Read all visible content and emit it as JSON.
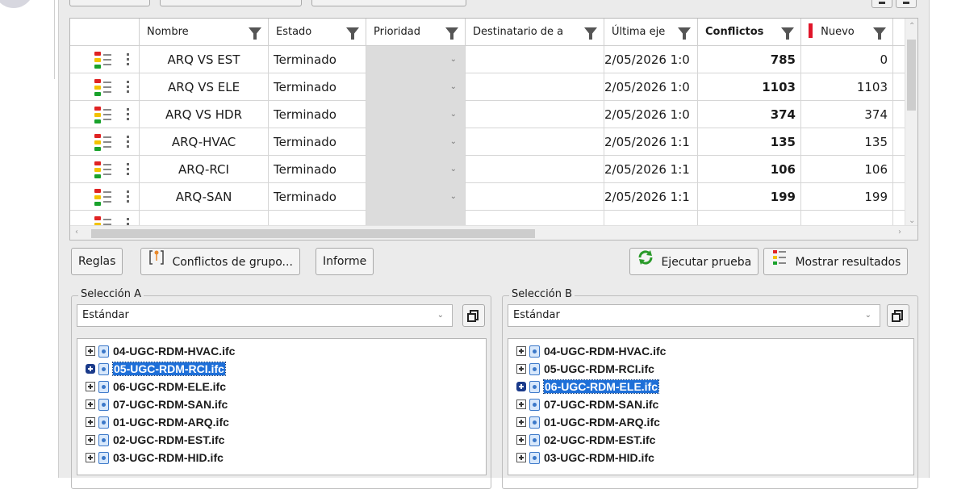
{
  "grid": {
    "headers": {
      "nombre": "Nombre",
      "estado": "Estado",
      "prioridad": "Prioridad",
      "destinatario": "Destinatario de a",
      "ultima": "Última eje",
      "conflictos": "Conflictos",
      "nuevo": "Nuevo"
    },
    "rows": [
      {
        "nombre": "ARQ VS EST",
        "estado": "Terminado",
        "ultima": "2/05/2026 1:0",
        "conflictos": "785",
        "nuevo": "0"
      },
      {
        "nombre": "ARQ VS ELE",
        "estado": "Terminado",
        "ultima": "2/05/2026 1:0",
        "conflictos": "1103",
        "nuevo": "1103"
      },
      {
        "nombre": "ARQ VS HDR",
        "estado": "Terminado",
        "ultima": "2/05/2026 1:0",
        "conflictos": "374",
        "nuevo": "374"
      },
      {
        "nombre": "ARQ-HVAC",
        "estado": "Terminado",
        "ultima": "2/05/2026 1:1",
        "conflictos": "135",
        "nuevo": "135"
      },
      {
        "nombre": "ARQ-RCI",
        "estado": "Terminado",
        "ultima": "2/05/2026 1:1",
        "conflictos": "106",
        "nuevo": "106"
      },
      {
        "nombre": "ARQ-SAN",
        "estado": "Terminado",
        "ultima": "2/05/2026 1:1",
        "conflictos": "199",
        "nuevo": "199"
      }
    ],
    "priority_value": "",
    "status_colors": {
      "red": "#e02323",
      "yellow": "#f2c200",
      "green": "#19a22b"
    }
  },
  "actions": {
    "reglas": "Reglas",
    "conflictos_grupo": "Conflictos de grupo...",
    "informe": "Informe",
    "ejecutar": "Ejecutar prueba",
    "mostrar": "Mostrar resultados"
  },
  "selection_a": {
    "title": "Selección A",
    "combo": "Estándar",
    "items": [
      {
        "label": "04-UGC-RDM-HVAC.ifc",
        "selected": false
      },
      {
        "label": "05-UGC-RDM-RCI.ifc",
        "selected": true
      },
      {
        "label": "06-UGC-RDM-ELE.ifc",
        "selected": false
      },
      {
        "label": "07-UGC-RDM-SAN.ifc",
        "selected": false
      },
      {
        "label": "01-UGC-RDM-ARQ.ifc",
        "selected": false
      },
      {
        "label": "02-UGC-RDM-EST.ifc",
        "selected": false
      },
      {
        "label": "03-UGC-RDM-HID.ifc",
        "selected": false
      }
    ]
  },
  "selection_b": {
    "title": "Selección B",
    "combo": "Estándar",
    "items": [
      {
        "label": "04-UGC-RDM-HVAC.ifc",
        "selected": false
      },
      {
        "label": "05-UGC-RDM-RCI.ifc",
        "selected": false
      },
      {
        "label": "06-UGC-RDM-ELE.ifc",
        "selected": true
      },
      {
        "label": "07-UGC-RDM-SAN.ifc",
        "selected": false
      },
      {
        "label": "01-UGC-RDM-ARQ.ifc",
        "selected": false
      },
      {
        "label": "02-UGC-RDM-EST.ifc",
        "selected": false
      },
      {
        "label": "03-UGC-RDM-HID.ifc",
        "selected": false
      }
    ]
  },
  "colors": {
    "accent_selection": "#1e6fd8",
    "new_flag": "#e0162a",
    "panel_bg": "#ebebeb"
  }
}
